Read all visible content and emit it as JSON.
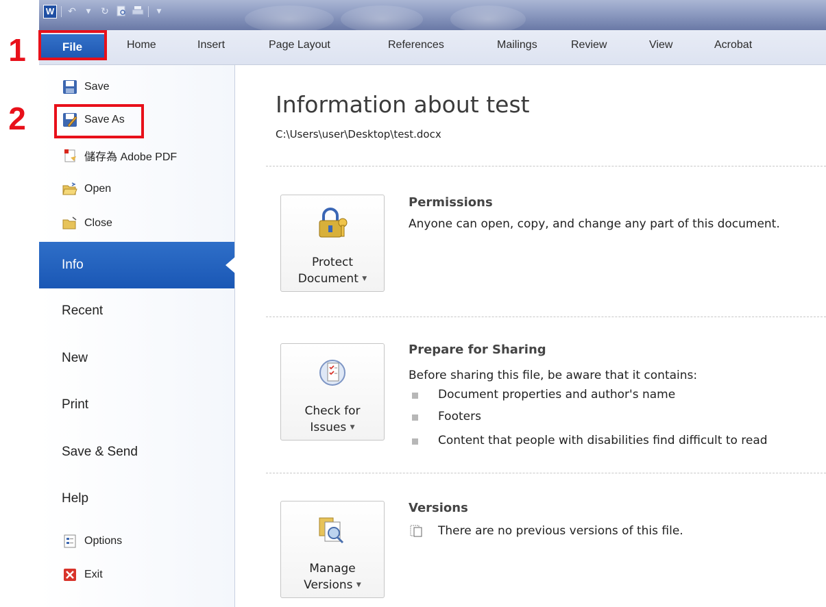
{
  "annotations": {
    "step1": "1",
    "step2": "2"
  },
  "quick_access": {
    "logo": "W"
  },
  "ribbon": {
    "file_tab": "File",
    "tabs": [
      "Home",
      "Insert",
      "Page Layout",
      "References",
      "Mailings",
      "Review",
      "View",
      "Acrobat"
    ]
  },
  "backstage": {
    "commands": {
      "save": "Save",
      "save_as": "Save As",
      "save_pdf": "儲存為 Adobe PDF",
      "open": "Open",
      "close": "Close"
    },
    "nav": {
      "info": "Info",
      "recent": "Recent",
      "new": "New",
      "print": "Print",
      "save_send": "Save & Send",
      "help": "Help"
    },
    "bottom": {
      "options": "Options",
      "exit": "Exit"
    }
  },
  "info": {
    "title": "Information about test",
    "path": "C:\\Users\\user\\Desktop\\test.docx",
    "permissions": {
      "button_line1": "Protect",
      "button_line2": "Document",
      "title": "Permissions",
      "text": "Anyone can open, copy, and change any part of this document."
    },
    "sharing": {
      "button_line1": "Check for",
      "button_line2": "Issues",
      "title": "Prepare for Sharing",
      "text": "Before sharing this file, be aware that it contains:",
      "items": [
        "Document properties and author's name",
        "Footers",
        "Content that people with disabilities find difficult to read"
      ]
    },
    "versions": {
      "button_line1": "Manage",
      "button_line2": "Versions",
      "title": "Versions",
      "text": "There are no previous versions of this file."
    }
  },
  "colors": {
    "accent_blue": "#1d55b0",
    "annotation_red": "#e8101a"
  }
}
